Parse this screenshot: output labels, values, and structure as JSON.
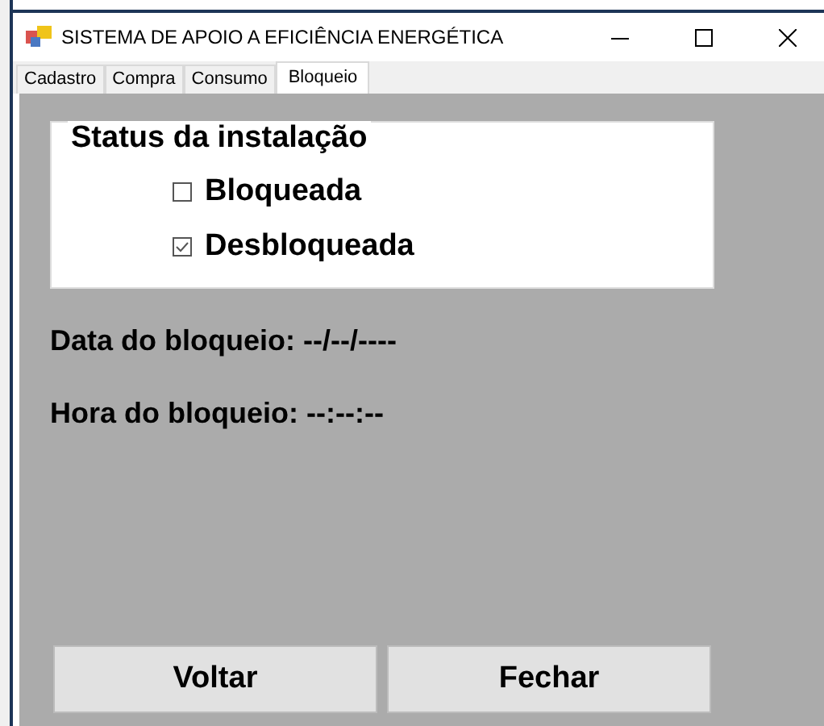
{
  "window": {
    "title": "SISTEMA DE APOIO A EFICIÊNCIA ENERGÉTICA"
  },
  "tabs": [
    {
      "label": "Cadastro",
      "selected": false
    },
    {
      "label": "Compra",
      "selected": false
    },
    {
      "label": "Consumo",
      "selected": false
    },
    {
      "label": "Bloqueio",
      "selected": true
    }
  ],
  "status_group": {
    "title": "Status da instalação",
    "options": [
      {
        "label": "Bloqueada",
        "checked": false
      },
      {
        "label": "Desbloqueada",
        "checked": true
      }
    ]
  },
  "fields": [
    "Data do bloqueio: --/--/----",
    "Hora do bloqueio: --:--:--"
  ],
  "buttons": [
    "Voltar",
    "Fechar"
  ]
}
